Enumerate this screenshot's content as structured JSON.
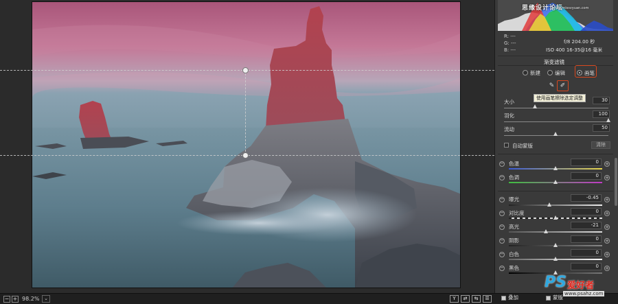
{
  "preview": {
    "zoom": "98.2%",
    "zoom_dropdown": "⌄",
    "minus": "−",
    "plus": "+",
    "view_buttons": [
      "Y",
      "⇄",
      "⇆",
      "☰"
    ]
  },
  "histogram": {
    "overlay_text": "思缘设计论坛",
    "overlay_url": "www.missvyuan.com"
  },
  "info": {
    "r": "R:   ---",
    "g": "G:   ---",
    "b": "B:   ---",
    "aperture_shutter": "f/8   204.00 秒",
    "iso_lens": "ISO 400   16-35@16 毫米"
  },
  "panel": {
    "title": "渐变滤镜",
    "mode_new": "新建",
    "mode_edit": "编辑",
    "mode_brush": "画笔",
    "tooltip": "使用画笔擦除选定调整",
    "brush": {
      "size_label": "大小",
      "size_value": "30",
      "feather_label": "羽化",
      "feather_value": "100",
      "flow_label": "流动",
      "flow_value": "50",
      "automask_label": "自动蒙版",
      "clear_label": "清除"
    },
    "adjustments": [
      {
        "label": "色温",
        "value": "0"
      },
      {
        "label": "色调",
        "value": "0"
      },
      {
        "label": "曝光",
        "value": "-0.45"
      },
      {
        "label": "对比度",
        "value": "0"
      },
      {
        "label": "高光",
        "value": "-21"
      },
      {
        "label": "阴影",
        "value": "0"
      },
      {
        "label": "白色",
        "value": "0"
      },
      {
        "label": "黑色",
        "value": "0"
      }
    ],
    "overlay_label": "叠加",
    "mask_label": "蒙版"
  },
  "watermark": {
    "ps": "PS",
    "cn": "爱好者",
    "url": "www.psahz.com"
  },
  "colors": {
    "accent": "#d9481e",
    "panel_bg": "#3a3a3a",
    "sky_top": "#b45d80",
    "sea": "#5e7f8f"
  }
}
